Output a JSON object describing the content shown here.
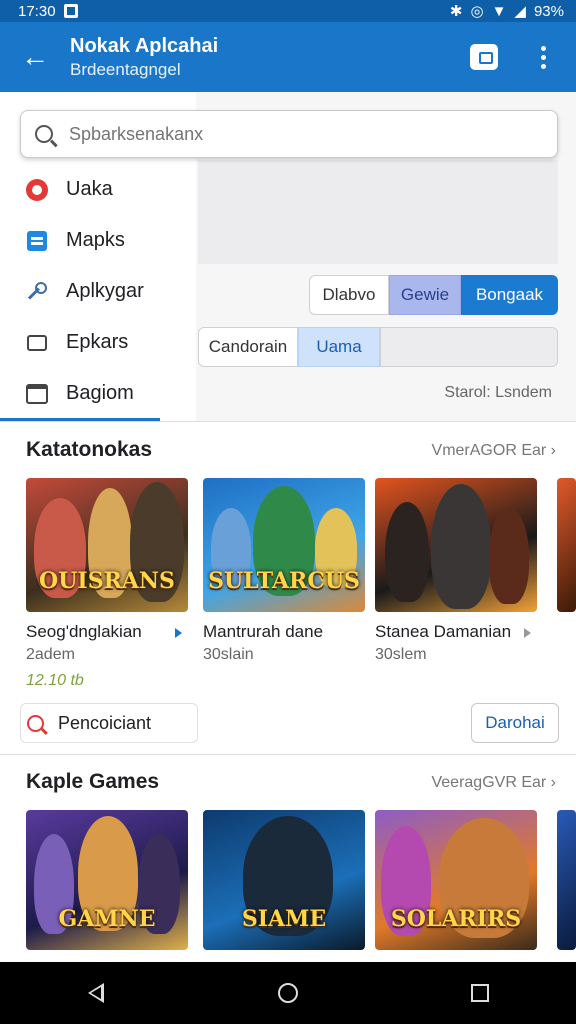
{
  "status_bar": {
    "time": "17:30",
    "battery": "93%"
  },
  "app_bar": {
    "title": "Nokak Aplcahai",
    "subtitle": "Brdeentagngel"
  },
  "search": {
    "placeholder": "Spbarksenakanx"
  },
  "menu": {
    "items": [
      {
        "label": "Uaka",
        "icon": "circle-icon"
      },
      {
        "label": "Mapks",
        "icon": "card-icon"
      },
      {
        "label": "Aplkygar",
        "icon": "key-icon"
      },
      {
        "label": "Epkars",
        "icon": "hand-icon"
      },
      {
        "label": "Bagiom",
        "icon": "store-icon"
      }
    ]
  },
  "filters": {
    "row1": [
      "Dlabvo",
      "Gewie",
      "Bongaak"
    ],
    "row2": [
      "Candorain",
      "Uama",
      ""
    ],
    "note": "Starol: Lsndem"
  },
  "section1": {
    "title": "Katatonokas",
    "more": "VmerAGOR Ear",
    "cards": [
      {
        "name": "Seog'dnglakian",
        "sub": "2adem",
        "art_title": "OUISRANS",
        "colors": [
          "#c44a3a",
          "#3a2e1e",
          "#b58a3a"
        ]
      },
      {
        "name": "Mantrurah dane",
        "sub": "30slain",
        "art_title": "SULTARCUS",
        "colors": [
          "#1f6fc4",
          "#3fa6e8",
          "#d98a3a"
        ]
      },
      {
        "name": "Stanea Damanian",
        "sub": "30slem",
        "art_title": "",
        "colors": [
          "#e3541f",
          "#1a1a1a",
          "#f2a23a"
        ]
      }
    ],
    "rating": "12.10 tb",
    "search_label": "Pencoiciant",
    "button": "Darohai"
  },
  "section2": {
    "title": "Kaple Games",
    "more": "VeeragGVR Ear",
    "cards": [
      {
        "art_title": "GAMNE",
        "colors": [
          "#5a3a9e",
          "#1c1b4a",
          "#e0b04a"
        ]
      },
      {
        "art_title": "SIAME",
        "colors": [
          "#0d3b6e",
          "#1b6fb8",
          "#0a1a2a"
        ]
      },
      {
        "art_title": "SOLARIRS",
        "colors": [
          "#8e5cc7",
          "#e07a2a",
          "#3a2a1a"
        ]
      }
    ]
  }
}
